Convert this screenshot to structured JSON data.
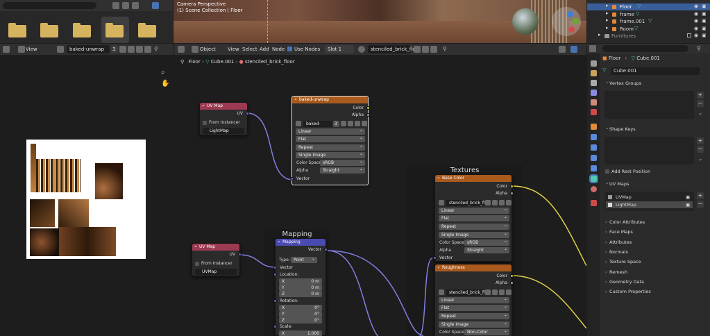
{
  "viewport": {
    "line1": "Camera Perspective",
    "line2": "(1) Scene Collection | Floor"
  },
  "outliner": {
    "items": [
      {
        "label": "Floor",
        "selected": true
      },
      {
        "label": "frame",
        "selected": false
      },
      {
        "label": "frame.001",
        "selected": false
      },
      {
        "label": "Room",
        "selected": false
      },
      {
        "label": "Furnitures",
        "selected": false
      }
    ]
  },
  "file_browser": {
    "filter_icon": "funnel-icon"
  },
  "image_editor": {
    "view_label": "View",
    "image_name": "baked-unwrap",
    "user_count": "3"
  },
  "node_editor": {
    "header": {
      "mode": "Object",
      "view": "View",
      "select": "Select",
      "add": "Add",
      "node": "Node",
      "use_nodes": "Use Nodes",
      "slot": "Slot 1",
      "material": "stenciled_brick_floor"
    },
    "breadcrumb": {
      "object": "Floor",
      "mesh": "Cube.001",
      "material": "stenciled_brick_floor"
    },
    "uvmap1": {
      "title": "UV Map",
      "uv": "UV",
      "from_instancer": "From Instancer",
      "map": "LightMap"
    },
    "uvmap2": {
      "title": "UV Map",
      "uv": "UV",
      "from_instancer": "From Instancer",
      "map": "UVMap"
    },
    "baked": {
      "title": "baked-unwrap",
      "color": "Color",
      "alpha": "Alpha",
      "image": "baked-unwrap",
      "users": "3",
      "interp": "Linear",
      "proj": "Flat",
      "ext": "Repeat",
      "source": "Single Image",
      "cs_label": "Color Space",
      "cs": "sRGB",
      "alpha_label": "Alpha",
      "alpha_mode": "Straight",
      "vector": "Vector"
    },
    "mapping_frame": "Mapping",
    "mapping": {
      "title": "Mapping",
      "vector_out": "Vector",
      "type_label": "Type:",
      "type": "Point",
      "vector_in": "Vector",
      "location": "Location:",
      "loc": [
        {
          "a": "X",
          "v": "0 m"
        },
        {
          "a": "Y",
          "v": "0 m"
        },
        {
          "a": "Z",
          "v": "0 m"
        }
      ],
      "rotation": "Rotation:",
      "rot": [
        {
          "a": "X",
          "v": "0°"
        },
        {
          "a": "Y",
          "v": "0°"
        },
        {
          "a": "Z",
          "v": "0°"
        }
      ],
      "scale": "Scale:",
      "sc": [
        {
          "a": "X",
          "v": "1.000"
        }
      ]
    },
    "textures_frame": "Textures",
    "base_color": {
      "title": "Base Color",
      "color": "Color",
      "alpha": "Alpha",
      "image": "stenciled_brick_fl...",
      "interp": "Linear",
      "proj": "Flat",
      "ext": "Repeat",
      "source": "Single Image",
      "cs_label": "Color Space",
      "cs": "sRGB",
      "alpha_label": "Alpha",
      "alpha_mode": "Straight",
      "vector": "Vector"
    },
    "roughness": {
      "title": "Roughness",
      "color": "Color",
      "alpha": "Alpha",
      "image": "stenciled_brick_fl...",
      "interp": "Linear",
      "proj": "Flat",
      "ext": "Repeat",
      "source": "Single Image",
      "cs_label": "Color Space",
      "cs": "Non-Color"
    }
  },
  "properties": {
    "breadcrumb_obj": "Floor",
    "breadcrumb_mesh": "Cube.001",
    "mesh_name": "Cube.001",
    "vertex_groups": "Vertex Groups",
    "shape_keys": "Shape Keys",
    "add_rest": "Add Rest Position",
    "uv_maps": "UV Maps",
    "uv_list": [
      {
        "label": "UVMap",
        "active": false
      },
      {
        "label": "LightMap",
        "active": true
      }
    ],
    "collapsed": [
      "Color Attributes",
      "Face Maps",
      "Attributes",
      "Normals",
      "Texture Space",
      "Remesh",
      "Geometry Data",
      "Custom Properties"
    ]
  },
  "colors": {
    "uv_header": "#9c3a52",
    "tex_header": "#a95a1c",
    "vec_header": "#4a4bb0",
    "yellow_wire": "#e0d04a",
    "purple_wire": "#8080e0",
    "selected_blue": "#3a5e9a"
  }
}
